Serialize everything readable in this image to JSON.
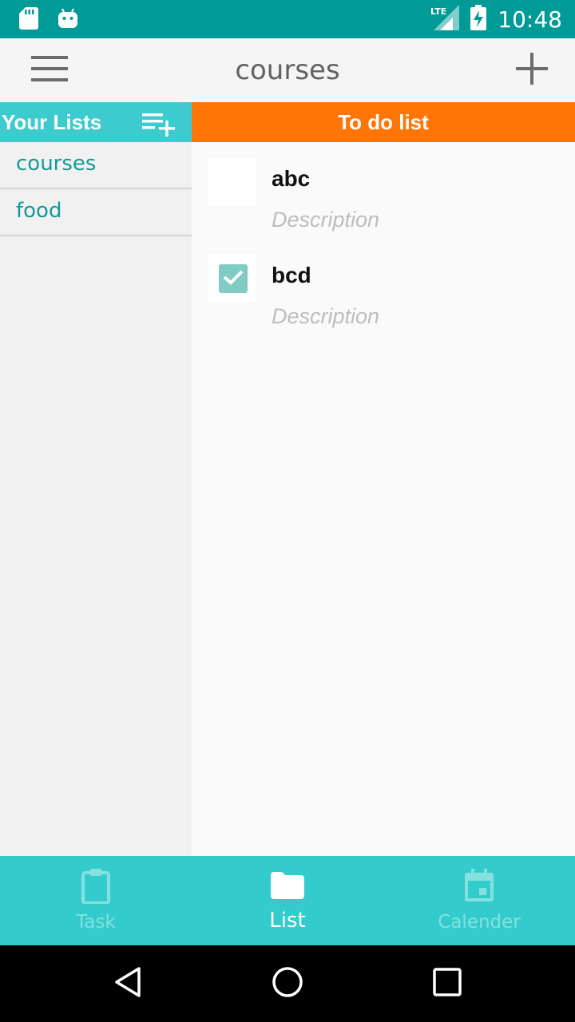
{
  "status_bar": {
    "time": "10:48",
    "network": "LTE"
  },
  "app_bar": {
    "title": "courses"
  },
  "lists_panel": {
    "header": "Your Lists",
    "items": [
      {
        "label": "courses"
      },
      {
        "label": "food"
      }
    ]
  },
  "todo_panel": {
    "header": "To do list",
    "items": [
      {
        "title": "abc",
        "description_placeholder": "Description",
        "checked": false
      },
      {
        "title": "bcd",
        "description_placeholder": "Description",
        "checked": true
      }
    ]
  },
  "bottom_nav": {
    "items": [
      {
        "label": "Task",
        "icon": "clipboard-icon",
        "active": false
      },
      {
        "label": "List",
        "icon": "folder-icon",
        "active": true
      },
      {
        "label": "Calender",
        "icon": "calendar-icon",
        "active": false
      }
    ]
  },
  "colors": {
    "status_bar": "#009b96",
    "accent_teal": "#3ecbcf",
    "todo_header": "#ff7507",
    "bottom_nav": "#33cbcc",
    "list_text": "#159a98",
    "checkbox_checked": "#80cbc4"
  }
}
